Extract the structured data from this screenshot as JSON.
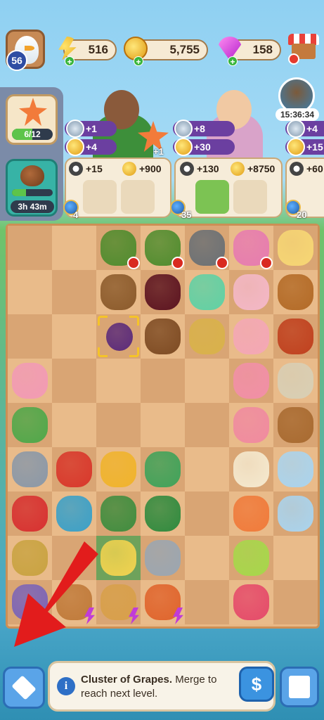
{
  "player": {
    "level": "56"
  },
  "resources": {
    "energy": "516",
    "coins": "5,755",
    "gems": "158"
  },
  "event": {
    "timer": "15:36:34"
  },
  "left_panel": {
    "starfish_progress": "6/12",
    "starfish_fraction": 0.5,
    "acorn_timer": "3h 43m",
    "acorn_fraction": 0.35
  },
  "orders": [
    {
      "bonus_top": "+1",
      "bonus_mid": "+4",
      "rewards": [
        "+15",
        "+900"
      ],
      "star_bonus": "+1",
      "globe_count": "4"
    },
    {
      "bonus_top": "+8",
      "bonus_mid": "+30",
      "rewards": [
        "+130",
        "+8750"
      ],
      "globe_count": "35"
    },
    {
      "bonus_top": "+4",
      "bonus_mid": "+15",
      "rewards": [
        "+60"
      ],
      "globe_count": "20"
    }
  ],
  "board": {
    "cols": 7,
    "rows": 9,
    "cells": [
      [
        "",
        "",
        "grapevine",
        "grapevine",
        "cash-register",
        "ice-cream-cart",
        "light-bulb"
      ],
      [
        "",
        "",
        "barrel",
        "wine-bottle",
        "soap-bottle",
        "ice-cream-cup",
        "telescope-tripod"
      ],
      [
        "",
        "",
        "grapes-selected",
        "wine-press",
        "sponge",
        "ice-cream-sundae",
        "spyglass"
      ],
      [
        "roses",
        "",
        "",
        "",
        "",
        "ice-cream-scoops",
        "compass"
      ],
      [
        "potted-plant",
        "",
        "",
        "",
        "",
        "ice-cream-cone",
        "sailing-ship"
      ],
      [
        "thimble",
        "tomatoes",
        "pincushion",
        "flower-pot",
        "",
        "soft-serve-cone",
        "ship-in-bottle"
      ],
      [
        "scarf",
        "mushroom-house",
        "palm-pot",
        "gardening-hat",
        "",
        "ice-pop",
        "bottle-ship"
      ],
      [
        "needle-thread",
        "",
        "corn-highlight",
        "trowel",
        "",
        "ice-pop-green",
        ""
      ],
      [
        "sewing-machine",
        "crate-bolt",
        "beehive-bolt",
        "market-stall-bolt",
        "",
        "ice-pop-pink",
        ""
      ]
    ]
  },
  "info": {
    "item_name": "Cluster of Grapes.",
    "message": "Merge to reach next level."
  },
  "buttons": {
    "sell_symbol": "$"
  },
  "colors": {
    "accent_red": "#d92a20",
    "board_tile": "#e8b886",
    "highlight": "#6ea25b"
  }
}
